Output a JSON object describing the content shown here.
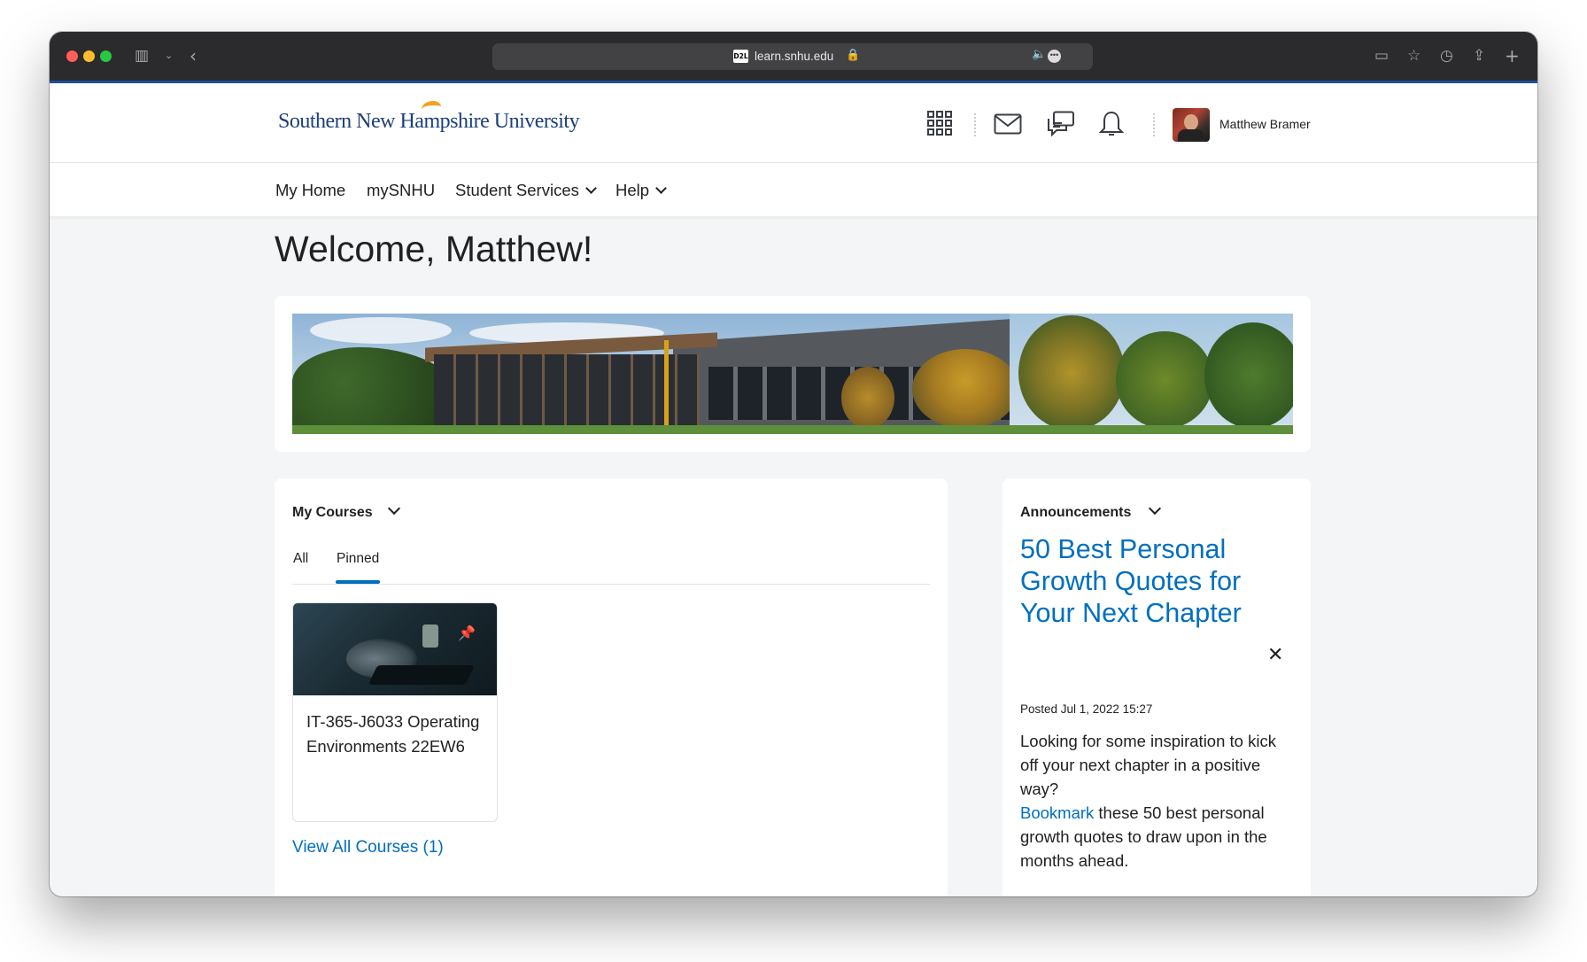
{
  "browser": {
    "url": "learn.snhu.edu",
    "favicon_text": "D2L"
  },
  "header": {
    "logo_text": "Southern New Hampshire University",
    "user_name": "Matthew Bramer"
  },
  "nav": {
    "items": [
      {
        "label": "My Home"
      },
      {
        "label": "mySNHU"
      },
      {
        "label": "Student Services"
      },
      {
        "label": "Help"
      }
    ]
  },
  "page": {
    "welcome": "Welcome, Matthew!"
  },
  "courses": {
    "title": "My Courses",
    "tabs": [
      "All",
      "Pinned"
    ],
    "active_tab": "Pinned",
    "course_title": "IT-365-J6033 Operating Environments 22EW6",
    "view_all": "View All Courses (1)"
  },
  "announcements": {
    "title": "Announcements",
    "headline": "50 Best Personal Growth Quotes for Your Next Chapter",
    "posted": "Posted Jul 1, 2022 15:27",
    "body_line1": "Looking for some inspiration to kick off your next chapter in a positive way?",
    "link": "Bookmark",
    "body_line2": " these 50 best personal growth quotes to draw upon in the months ahead."
  },
  "colors": {
    "accent": "#006fbf",
    "toolbar": "#2b2b2d",
    "page_bg": "#f4f5f6"
  }
}
